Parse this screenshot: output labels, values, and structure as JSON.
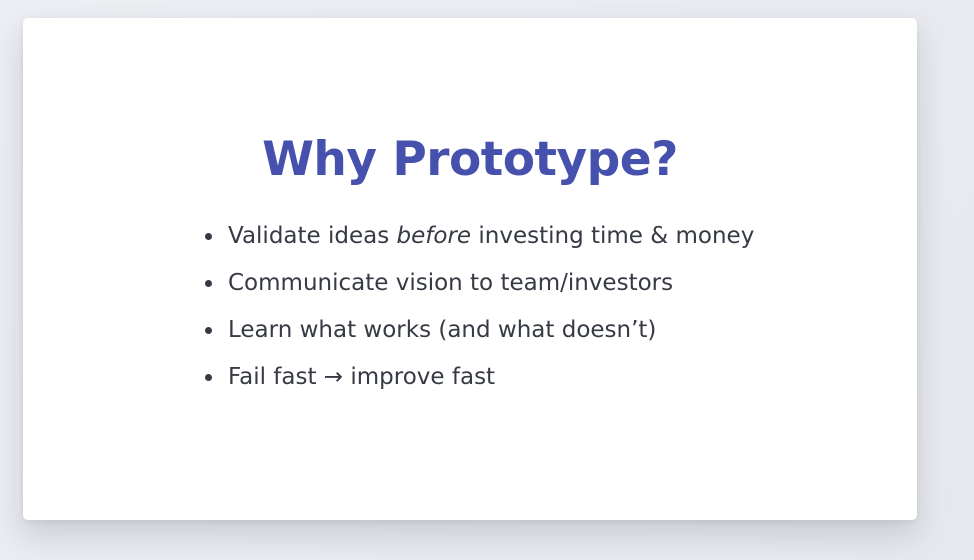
{
  "slide": {
    "title": "Why Prototype?",
    "bullets": [
      {
        "before": "Validate ideas ",
        "emphasis": "before",
        "after": " investing time & money"
      },
      {
        "before": "Communicate vision to team/investors",
        "emphasis": "",
        "after": ""
      },
      {
        "before": "Learn what works (and what doesn’t)",
        "emphasis": "",
        "after": ""
      },
      {
        "before": "Fail fast → improve fast",
        "emphasis": "",
        "after": ""
      }
    ]
  },
  "colors": {
    "title": "#4650ad",
    "body_text": "#363a44",
    "slide_background": "#ffffff",
    "page_background": "#eceef3"
  },
  "icons": {
    "bullet": "bullet-dot-icon"
  }
}
